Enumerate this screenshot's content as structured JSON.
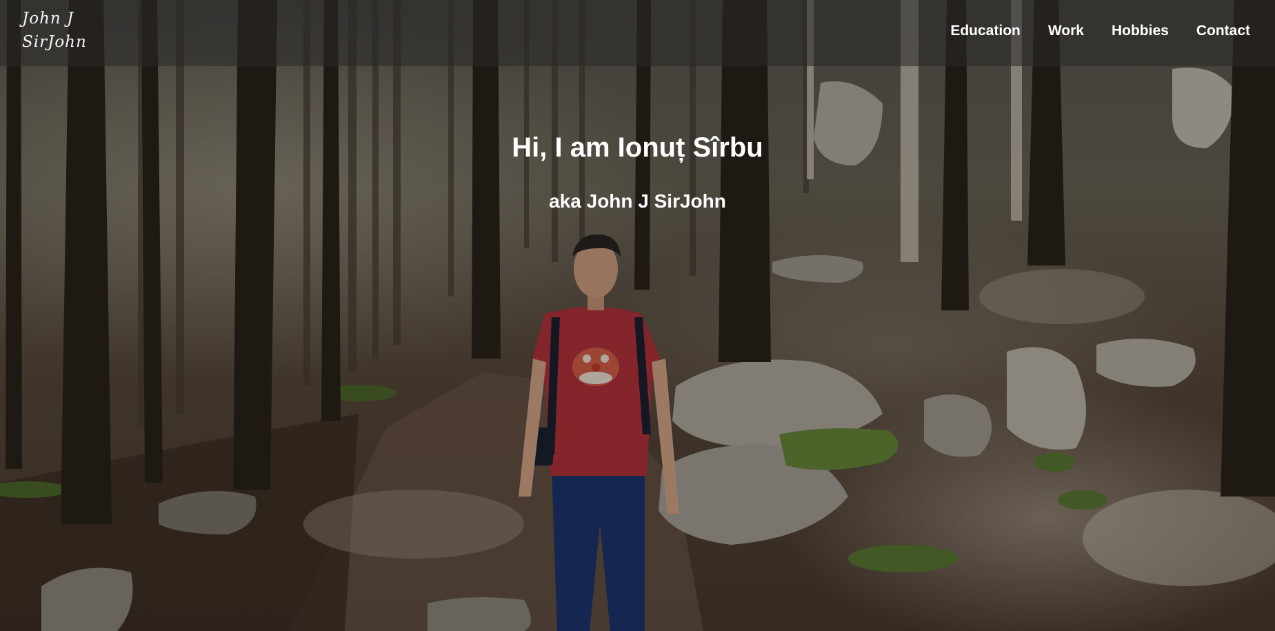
{
  "header": {
    "logo_text": "John J\nSirJohn"
  },
  "nav": {
    "items": [
      {
        "label": "Education"
      },
      {
        "label": "Work"
      },
      {
        "label": "Hobbies"
      },
      {
        "label": "Contact"
      }
    ]
  },
  "hero": {
    "title": "Hi, I am Ionuț Sîrbu",
    "subtitle": "aka John J SirJohn"
  },
  "colors": {
    "nav_background": "rgba(40,40,40,0.55)",
    "text": "#ffffff",
    "shirt": "#b8323c",
    "pants": "#1e3570"
  }
}
